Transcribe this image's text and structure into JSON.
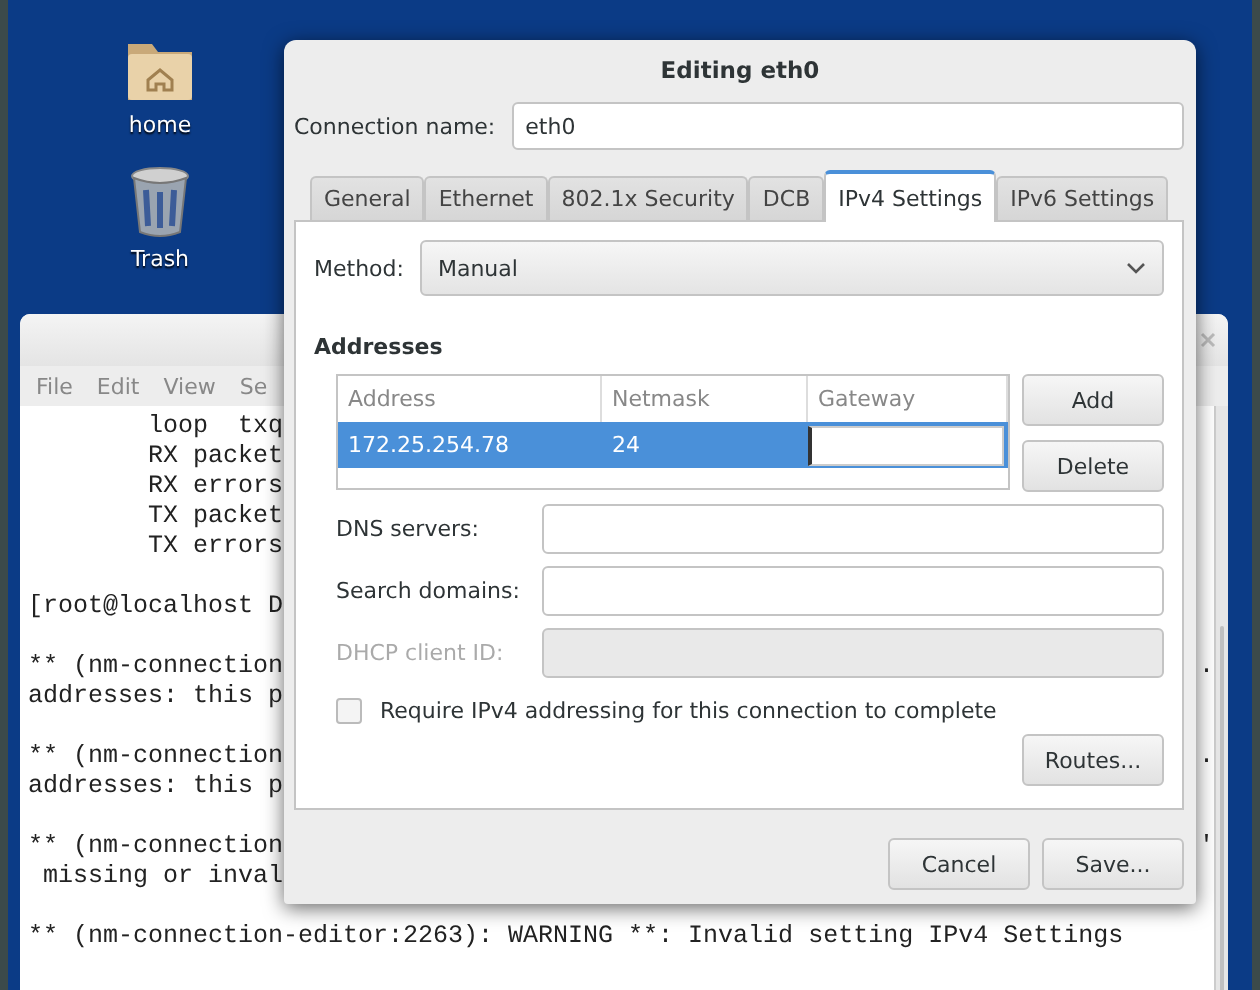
{
  "desktop_icons": [
    {
      "label": "home",
      "kind": "folder"
    },
    {
      "label": "Trash",
      "kind": "trash"
    }
  ],
  "terminal": {
    "menu": [
      "File",
      "Edit",
      "View",
      "Se"
    ],
    "blocks": [
      {
        "lines": [
          "        loop  txq",
          "        RX packet",
          "        RX errors",
          "        TX packet",
          "        TX errors"
        ]
      },
      {
        "lines": [
          "[root@localhost D"
        ]
      },
      {
        "lines": [
          "** (nm-connection",
          "addresses: this p"
        ],
        "tail": "."
      },
      {
        "lines": [
          "** (nm-connection",
          "addresses: this p"
        ],
        "tail": "."
      },
      {
        "lines": [
          "** (nm-connection",
          " missing or inval"
        ],
        "tail": "'"
      },
      {
        "lines": [
          "** (nm-connection-editor:2263): WARNING **: Invalid setting IPv4 Settings"
        ]
      }
    ]
  },
  "dialog": {
    "title": "Editing eth0",
    "connection_name": {
      "label": "Connection name:",
      "value": "eth0"
    },
    "tabs": [
      {
        "label": "General",
        "selected": false
      },
      {
        "label": "Ethernet",
        "selected": false
      },
      {
        "label": "802.1x Security",
        "selected": false
      },
      {
        "label": "DCB",
        "selected": false
      },
      {
        "label": "IPv4 Settings",
        "selected": true
      },
      {
        "label": "IPv6 Settings",
        "selected": false
      }
    ],
    "method": {
      "label": "Method:",
      "value": "Manual"
    },
    "addresses": {
      "heading": "Addresses",
      "columns": [
        "Address",
        "Netmask",
        "Gateway"
      ],
      "rows": [
        {
          "address": "172.25.254.78",
          "netmask": "24",
          "selected": true,
          "editing_gateway": true
        }
      ],
      "buttons": [
        "Add",
        "Delete"
      ]
    },
    "fields": [
      {
        "label": "DNS servers:",
        "disabled": false
      },
      {
        "label": "Search domains:",
        "disabled": false
      },
      {
        "label": "DHCP client ID:",
        "disabled": true
      }
    ],
    "require_checkbox": {
      "label": "Require IPv4 addressing for this connection to complete",
      "checked": false
    },
    "routes_button": "Routes...",
    "footer_buttons": [
      "Cancel",
      "Save..."
    ]
  }
}
